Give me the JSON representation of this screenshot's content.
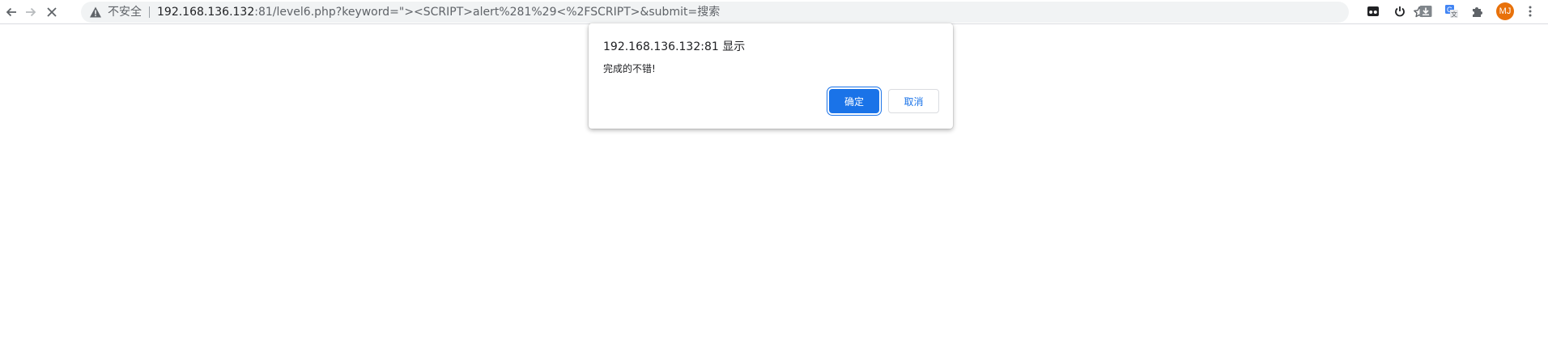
{
  "browser": {
    "security_label": "不安全",
    "url_host": "192.168.136.132",
    "url_rest": ":81/level6.php?keyword=\"><SCRIPT>alert%281%29<%2FSCRIPT>&submit=搜索",
    "profile_initials": "MJ"
  },
  "icons": {
    "back": "arrow-left-icon",
    "forward": "arrow-right-icon",
    "stop": "close-icon",
    "security": "warning-triangle-icon",
    "bookmark": "star-icon",
    "extension1": "ext-glasses-icon",
    "extension2": "power-icon",
    "extension3": "download-icon",
    "extension4": "translate-icon",
    "extensions_menu": "puzzle-icon",
    "menu": "kebab-menu-icon"
  },
  "dialog": {
    "title": "192.168.136.132:81 显示",
    "message": "完成的不错!",
    "ok_label": "确定",
    "cancel_label": "取消"
  },
  "colors": {
    "accent": "#1a73e8",
    "avatar": "#e8710a"
  }
}
